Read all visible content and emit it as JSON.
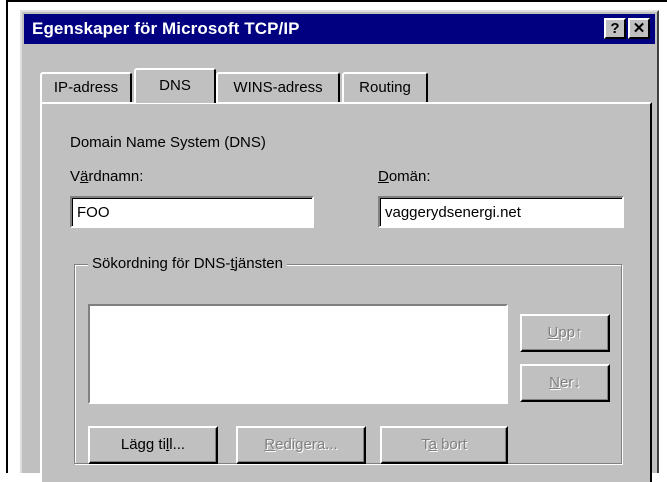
{
  "window": {
    "title": "Egenskaper för Microsoft TCP/IP",
    "help_button": "?",
    "close_button": "✕"
  },
  "tabs": [
    {
      "label": "IP-adress",
      "active": false
    },
    {
      "label": "DNS",
      "active": true
    },
    {
      "label": "WINS-adress",
      "active": false
    },
    {
      "label": "Routing",
      "active": false
    }
  ],
  "dns": {
    "section_title": "Domain Name System (DNS)",
    "hostname_label": {
      "pre": "V",
      "accel": "ä",
      "post": "rdnamn:"
    },
    "hostname_value": "FOO",
    "domain_label": {
      "pre": "",
      "accel": "D",
      "post": "omän:"
    },
    "domain_value": "vaggerydsenergi.net"
  },
  "search_order": {
    "group_label": {
      "pre": "Sökordning för DNS-",
      "accel": "t",
      "post": "jänsten"
    },
    "entries": [],
    "up_button": {
      "pre": "",
      "accel": "U",
      "post": "pp↑"
    },
    "down_button": {
      "pre": "",
      "accel": "N",
      "post": "er↓"
    },
    "add_button": {
      "pre": "Lägg ti",
      "accel": "l",
      "post": "l..."
    },
    "edit_button": {
      "pre": "",
      "accel": "R",
      "post": "edigera..."
    },
    "remove_button": {
      "pre": "T",
      "accel": "a",
      "post": " bort"
    }
  }
}
